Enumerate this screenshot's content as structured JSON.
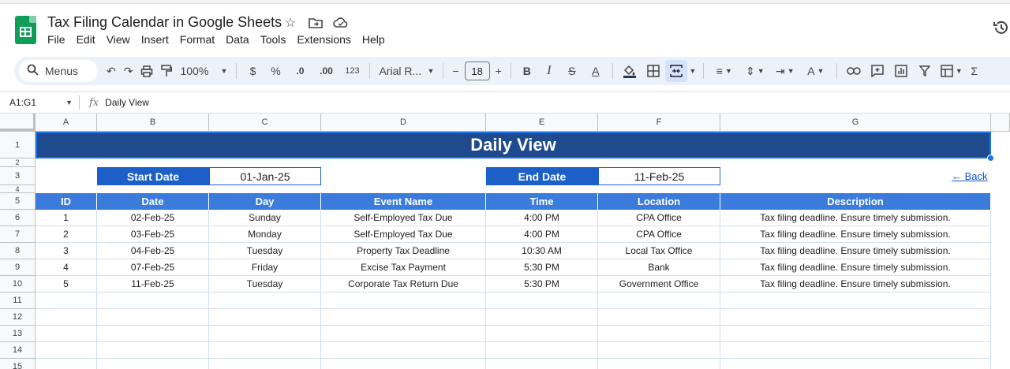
{
  "app": {
    "title": "Tax Filing Calendar in Google Sheets",
    "menu": [
      "File",
      "Edit",
      "View",
      "Insert",
      "Format",
      "Data",
      "Tools",
      "Extensions",
      "Help"
    ]
  },
  "toolbar": {
    "menus_label": "Menus",
    "zoom": "100%",
    "currency": "$",
    "percent": "%",
    "decrease_decimal": ".0",
    "increase_decimal": ".00",
    "number_format": "123",
    "font": "Arial R...",
    "font_size": "18"
  },
  "formula_bar": {
    "name_box": "A1:G1",
    "fx": "fx",
    "content": "Daily View"
  },
  "columns": [
    "A",
    "B",
    "C",
    "D",
    "E",
    "F",
    "G"
  ],
  "rows": [
    "1",
    "2",
    "3",
    "4",
    "5",
    "6",
    "7",
    "8",
    "9",
    "10",
    "11",
    "12",
    "13",
    "14",
    "15"
  ],
  "sheet": {
    "banner": "Daily View",
    "start_date_label": "Start Date",
    "start_date_value": "01-Jan-25",
    "end_date_label": "End Date",
    "end_date_value": "11-Feb-25",
    "back_link": "← Back",
    "table_headers": [
      "ID",
      "Date",
      "Day",
      "Event Name",
      "Time",
      "Location",
      "Description"
    ],
    "table_rows": [
      [
        "1",
        "02-Feb-25",
        "Sunday",
        "Self-Employed Tax Due",
        "4:00 PM",
        "CPA Office",
        "Tax filing deadline. Ensure timely submission."
      ],
      [
        "2",
        "03-Feb-25",
        "Monday",
        "Self-Employed Tax Due",
        "4:00 PM",
        "CPA Office",
        "Tax filing deadline. Ensure timely submission."
      ],
      [
        "3",
        "04-Feb-25",
        "Tuesday",
        "Property Tax Deadline",
        "10:30 AM",
        "Local Tax Office",
        "Tax filing deadline. Ensure timely submission."
      ],
      [
        "4",
        "07-Feb-25",
        "Friday",
        "Excise Tax Payment",
        "5:30 PM",
        "Bank",
        "Tax filing deadline. Ensure timely submission."
      ],
      [
        "5",
        "11-Feb-25",
        "Tuesday",
        "Corporate Tax Return Due",
        "5:30 PM",
        "Government Office",
        "Tax filing deadline. Ensure timely submission."
      ]
    ]
  },
  "colors": {
    "banner": "#1f4b8e",
    "label_fill": "#1d5fc9",
    "header_fill": "#3a7bdb",
    "link": "#1155cc"
  }
}
